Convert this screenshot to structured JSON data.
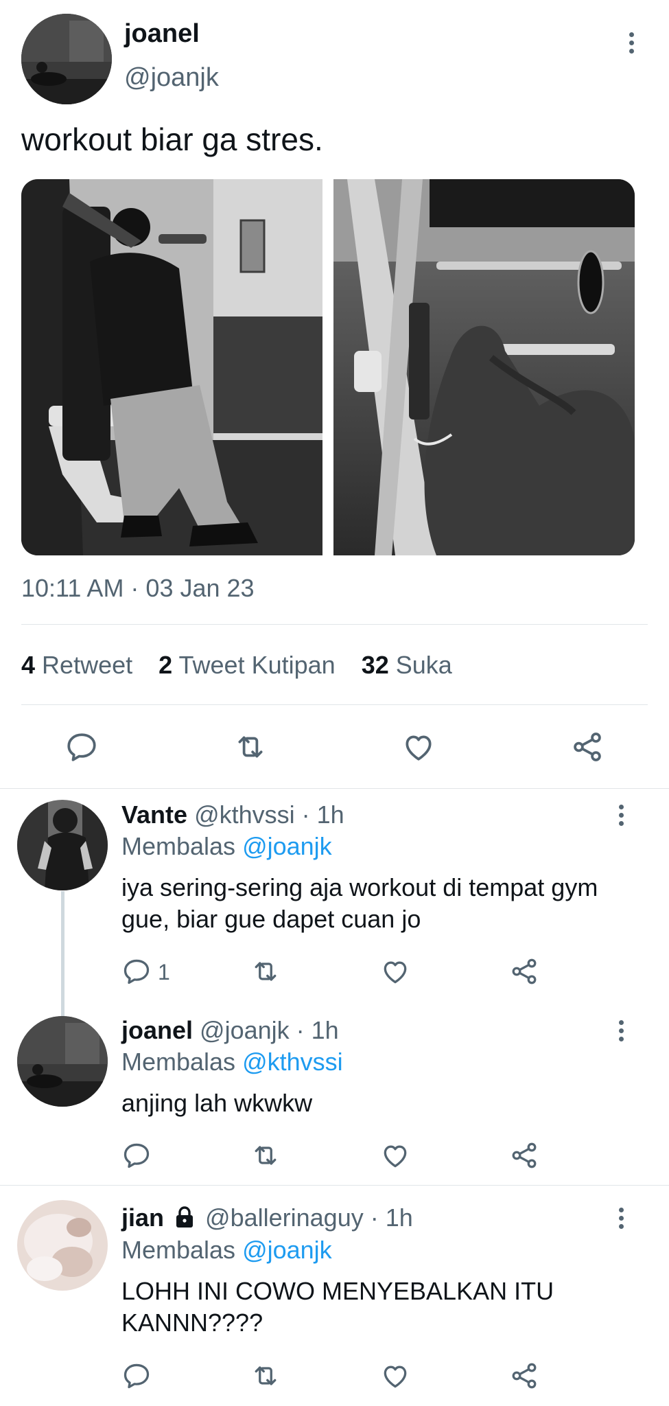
{
  "tweet": {
    "author_name": "joanel",
    "author_handle": "@joanjk",
    "text": "workout biar ga stres.",
    "timestamp": "10:11 AM · 03 Jan 23",
    "stats": {
      "retweets_count": "4",
      "retweets_label": "Retweet",
      "quotes_count": "2",
      "quotes_label": "Tweet Kutipan",
      "likes_count": "32",
      "likes_label": "Suka"
    }
  },
  "replies": [
    {
      "name": "Vante",
      "handle": "@kthvssi",
      "time": "· 1h",
      "replying_label": "Membalas",
      "replying_to": "@joanjk",
      "text": "iya sering-sering aja workout di tempat gym gue, biar gue dapet cuan jo",
      "reply_count": "1"
    },
    {
      "name": "joanel",
      "handle": "@joanjk",
      "time": "· 1h",
      "replying_label": "Membalas",
      "replying_to": "@kthvssi",
      "text": "anjing lah wkwkw",
      "reply_count": ""
    },
    {
      "name": "jian",
      "handle": "@ballerinaguy",
      "time": "· 1h",
      "replying_label": "Membalas",
      "replying_to": "@joanjk",
      "text": "LOHH INI COWO MENYEBALKAN ITU KANNN????",
      "reply_count": ""
    }
  ],
  "icons": {
    "more": "more-vertical-icon",
    "reply": "reply-icon",
    "retweet": "retweet-icon",
    "like": "heart-icon",
    "share": "share-icon",
    "lock": "lock-icon"
  },
  "colors": {
    "text": "#0f1419",
    "muted": "#536471",
    "link": "#1d9bf0",
    "divider": "#e1e5e8"
  }
}
